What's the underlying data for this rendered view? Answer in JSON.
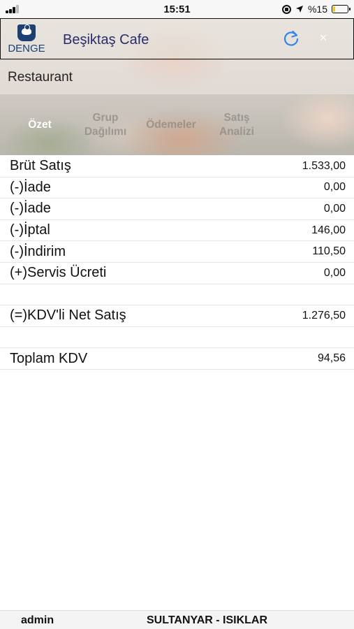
{
  "status_bar": {
    "time": "15:51",
    "battery_text": "%15",
    "battery_level": 0.15,
    "battery_color": "#f3c51b"
  },
  "header": {
    "logo_text": "DENGE",
    "title": "Beşiktaş Cafe",
    "refresh_icon": "refresh-icon",
    "close_label": "×"
  },
  "restaurant": {
    "label": "Restaurant"
  },
  "tabs": [
    {
      "label": "Özet",
      "active": true
    },
    {
      "label": "Grup Dağılımı",
      "active": false
    },
    {
      "label": "Ödemeler",
      "active": false
    },
    {
      "label": "Satış Analizi",
      "active": false
    }
  ],
  "report": {
    "rows": [
      {
        "label": "Brüt Satış",
        "value": "1.533,00"
      },
      {
        "label": "(-)İade",
        "value": "0,00"
      },
      {
        "label": "(-)İade",
        "value": "0,00"
      },
      {
        "label": "(-)İptal",
        "value": "146,00"
      },
      {
        "label": "(-)İndirim",
        "value": "110,50"
      },
      {
        "label": "(+)Servis Ücreti",
        "value": "0,00"
      },
      {
        "label": "",
        "value": ""
      },
      {
        "label": "(=)KDV'li Net Satış",
        "value": "1.276,50"
      },
      {
        "label": "",
        "value": ""
      },
      {
        "label": "Toplam KDV",
        "value": "94,56"
      }
    ]
  },
  "footer": {
    "user": "admin",
    "branch": "SULTANYAR - ISIKLAR"
  },
  "colors": {
    "accent_blue": "#2f86e8",
    "title_color": "#2a2c6a",
    "logo_blue": "#1c3f74"
  }
}
